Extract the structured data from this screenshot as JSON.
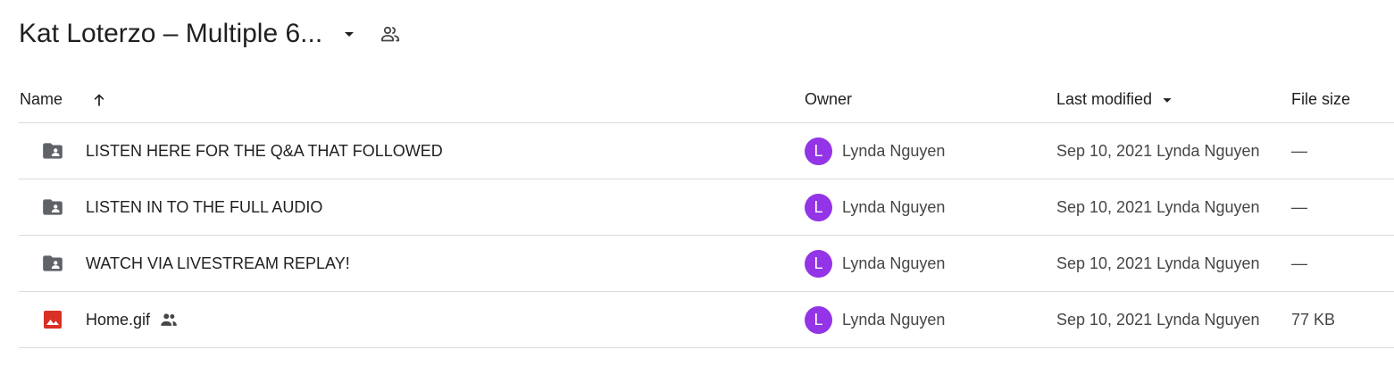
{
  "header": {
    "folder_title": "Kat Loterzo – Multiple 6...",
    "dropdown_icon": "arrow-drop-down-icon",
    "share_icon": "people-icon"
  },
  "columns": {
    "name": "Name",
    "owner": "Owner",
    "last_modified": "Last modified",
    "file_size": "File size",
    "sort_icon": "arrow-up-icon",
    "modified_sort_icon": "arrow-drop-down-icon"
  },
  "rows": [
    {
      "icon": "shared-folder-icon",
      "name": "LISTEN HERE FOR THE Q&A THAT FOLLOWED",
      "owner_initial": "L",
      "owner": "Lynda Nguyen",
      "modified": "Sep 10, 2021 Lynda Nguyen",
      "size": "—"
    },
    {
      "icon": "shared-folder-icon",
      "name": "LISTEN IN TO THE FULL AUDIO",
      "owner_initial": "L",
      "owner": "Lynda Nguyen",
      "modified": "Sep 10, 2021 Lynda Nguyen",
      "size": "—"
    },
    {
      "icon": "shared-folder-icon",
      "name": "WATCH VIA LIVESTREAM REPLAY!",
      "owner_initial": "L",
      "owner": "Lynda Nguyen",
      "modified": "Sep 10, 2021 Lynda Nguyen",
      "size": "—"
    },
    {
      "icon": "image-file-icon",
      "name": "Home.gif",
      "shared_icon": "people-icon",
      "owner_initial": "L",
      "owner": "Lynda Nguyen",
      "modified": "Sep 10, 2021 Lynda Nguyen",
      "size": "77 KB"
    }
  ],
  "colors": {
    "avatar": "#9334e6",
    "folder_icon": "#5f6368",
    "image_icon": "#d93025",
    "divider": "#dadce0"
  }
}
